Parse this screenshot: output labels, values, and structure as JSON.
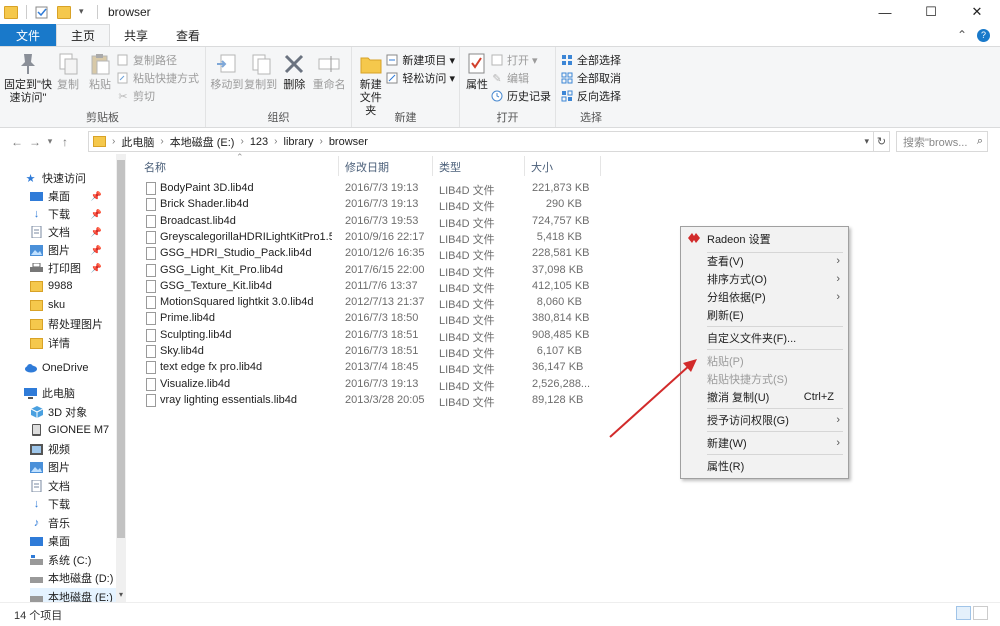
{
  "window": {
    "title": "browser",
    "minimize": "—",
    "maximize": "☐",
    "close": "✕"
  },
  "ribbon_tabs": {
    "file": "文件",
    "home": "主页",
    "share": "共享",
    "view": "查看"
  },
  "ribbon": {
    "clipboard": {
      "label": "剪贴板",
      "pin_quick": "固定到\"快速访问\"",
      "copy": "复制",
      "paste": "粘贴",
      "copy_path": "复制路径",
      "paste_shortcut": "粘贴快捷方式",
      "cut": "剪切"
    },
    "organize": {
      "label": "组织",
      "move_to": "移动到",
      "copy_to": "复制到",
      "delete": "删除",
      "rename": "重命名"
    },
    "new": {
      "label": "新建",
      "new_folder": "新建\n文件夹",
      "new_item": "新建项目 ▾",
      "easy_access": "轻松访问 ▾"
    },
    "open": {
      "label": "打开",
      "properties": "属性",
      "open": "打开 ▾",
      "edit": "编辑",
      "history": "历史记录"
    },
    "select": {
      "label": "选择",
      "select_all": "全部选择",
      "select_none": "全部取消",
      "invert": "反向选择"
    }
  },
  "address": {
    "crumbs": [
      "此电脑",
      "本地磁盘 (E:)",
      "123",
      "library",
      "browser"
    ],
    "search_placeholder": "搜索\"brows..."
  },
  "nav": {
    "quick_access": "快速访问",
    "desktop": "桌面",
    "downloads": "下载",
    "documents": "文档",
    "pictures": "图片",
    "printer": "打印图",
    "f9988": "9988",
    "sku": "sku",
    "help_images": "帮处理图片",
    "details": "详情",
    "onedrive": "OneDrive",
    "this_pc": "此电脑",
    "objects3d": "3D 对象",
    "gionee": "GIONEE M7",
    "videos": "视频",
    "pc_pictures": "图片",
    "pc_documents": "文档",
    "pc_downloads": "下载",
    "music": "音乐",
    "pc_desktop": "桌面",
    "drive_c": "系统 (C:)",
    "drive_d": "本地磁盘 (D:)",
    "drive_e": "本地磁盘 (E:)"
  },
  "columns": {
    "name": "名称",
    "date": "修改日期",
    "type": "类型",
    "size": "大小"
  },
  "files": [
    {
      "name": "BodyPaint 3D.lib4d",
      "date": "2016/7/3 19:13",
      "type": "LIB4D 文件",
      "size": "221,873 KB"
    },
    {
      "name": "Brick Shader.lib4d",
      "date": "2016/7/3 19:13",
      "type": "LIB4D 文件",
      "size": "290 KB"
    },
    {
      "name": "Broadcast.lib4d",
      "date": "2016/7/3 19:53",
      "type": "LIB4D 文件",
      "size": "724,757 KB"
    },
    {
      "name": "GreyscalegorillaHDRILightKitPro1.5.li...",
      "date": "2010/9/16 22:17",
      "type": "LIB4D 文件",
      "size": "5,418 KB"
    },
    {
      "name": "GSG_HDRI_Studio_Pack.lib4d",
      "date": "2010/12/6 16:35",
      "type": "LIB4D 文件",
      "size": "228,581 KB"
    },
    {
      "name": "GSG_Light_Kit_Pro.lib4d",
      "date": "2017/6/15 22:00",
      "type": "LIB4D 文件",
      "size": "37,098 KB"
    },
    {
      "name": "GSG_Texture_Kit.lib4d",
      "date": "2011/7/6 13:37",
      "type": "LIB4D 文件",
      "size": "412,105 KB"
    },
    {
      "name": "MotionSquared lightkit 3.0.lib4d",
      "date": "2012/7/13 21:37",
      "type": "LIB4D 文件",
      "size": "8,060 KB"
    },
    {
      "name": "Prime.lib4d",
      "date": "2016/7/3 18:50",
      "type": "LIB4D 文件",
      "size": "380,814 KB"
    },
    {
      "name": "Sculpting.lib4d",
      "date": "2016/7/3 18:51",
      "type": "LIB4D 文件",
      "size": "908,485 KB"
    },
    {
      "name": "Sky.lib4d",
      "date": "2016/7/3 18:51",
      "type": "LIB4D 文件",
      "size": "6,107 KB"
    },
    {
      "name": "text edge fx pro.lib4d",
      "date": "2013/7/4 18:45",
      "type": "LIB4D 文件",
      "size": "36,147 KB"
    },
    {
      "name": "Visualize.lib4d",
      "date": "2016/7/3 19:13",
      "type": "LIB4D 文件",
      "size": "2,526,288..."
    },
    {
      "name": "vray lighting essentials.lib4d",
      "date": "2013/3/28 20:05",
      "type": "LIB4D 文件",
      "size": "89,128 KB"
    }
  ],
  "status": {
    "count": "14 个项目"
  },
  "context_menu": {
    "radeon": "Radeon 设置",
    "view": "查看(V)",
    "sort": "排序方式(O)",
    "group": "分组依据(P)",
    "refresh": "刷新(E)",
    "customize": "自定义文件夹(F)...",
    "paste": "粘贴(P)",
    "paste_shortcut": "粘贴快捷方式(S)",
    "undo_copy": "撤消 复制(U)",
    "undo_shortcut": "Ctrl+Z",
    "grant_access": "授予访问权限(G)",
    "new": "新建(W)",
    "properties": "属性(R)"
  },
  "colors": {
    "accent": "#1979ca",
    "annotation_arrow": "#d22b2b"
  }
}
